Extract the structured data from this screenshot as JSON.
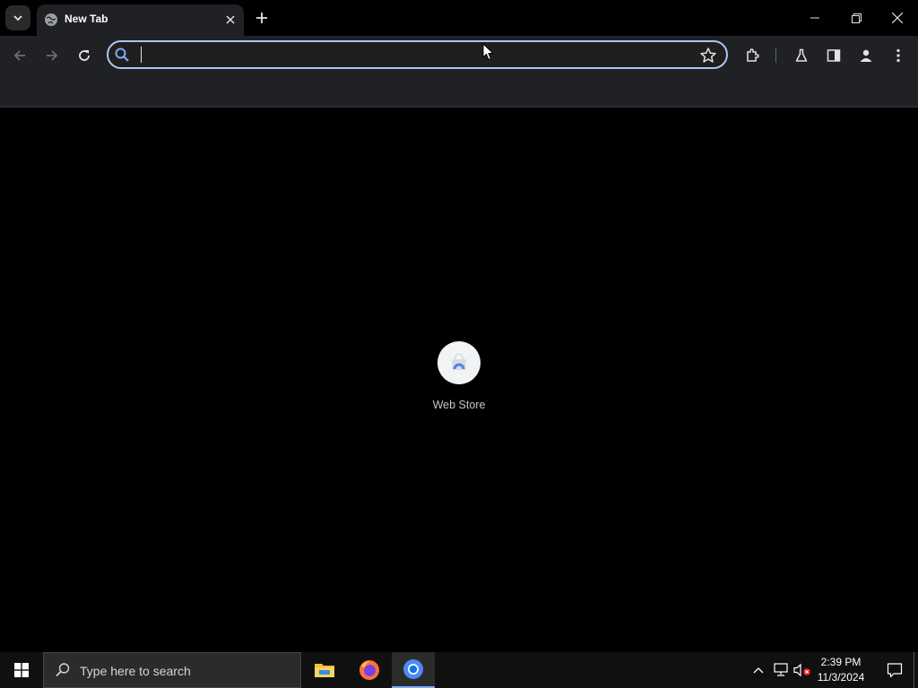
{
  "browser": {
    "tab": {
      "title": "New Tab",
      "icon": "globe-icon"
    },
    "omnibox": {
      "value": "",
      "placeholder": ""
    },
    "window_controls": {
      "minimize": "minimize-icon",
      "restore": "restore-icon",
      "close": "close-icon"
    },
    "toolbar_icons": [
      "back-arrow-icon",
      "forward-arrow-icon",
      "reload-icon",
      "star-icon",
      "extensions-icon",
      "labs-flask-icon",
      "side-panel-icon",
      "profile-icon",
      "more-menu-icon"
    ]
  },
  "new_tab_page": {
    "shortcuts": [
      {
        "label": "Web Store",
        "icon": "web-store-icon"
      }
    ]
  },
  "taskbar": {
    "search_placeholder": "Type here to search",
    "apps": [
      "file-explorer-icon",
      "firefox-icon",
      "chrome-icon"
    ],
    "active_app": "chrome-icon",
    "time": "2:39 PM",
    "date": "11/3/2024",
    "tray_icons": [
      "chevron-up-icon",
      "network-icon",
      "volume-muted-icon",
      "notification-icon"
    ]
  },
  "colors": {
    "accent": "#a8c7fa",
    "toolbar_bg": "#202124",
    "page_bg": "#000000",
    "taskbar_bg": "#101010"
  }
}
